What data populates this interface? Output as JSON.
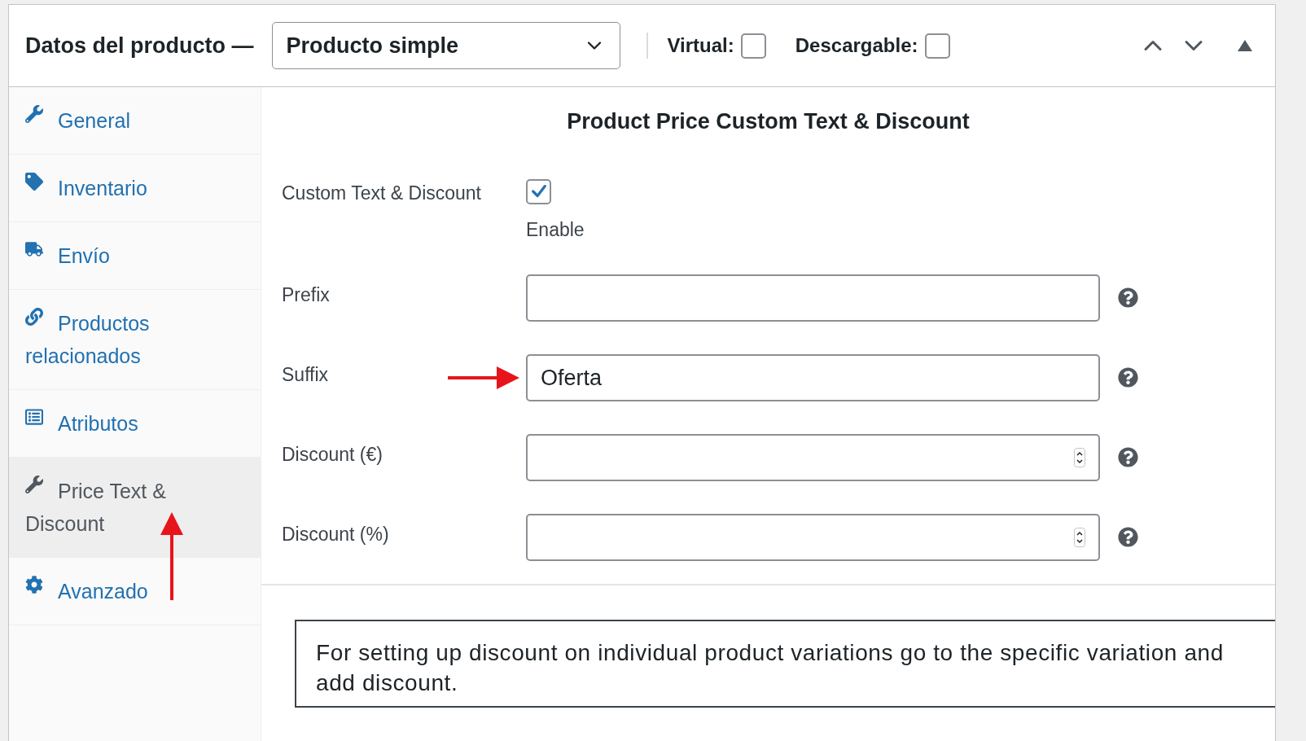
{
  "header": {
    "title": "Datos del producto —",
    "product_type": "Producto simple",
    "options": [
      {
        "label": "Virtual:",
        "checked": false
      },
      {
        "label": "Descargable:",
        "checked": false
      }
    ]
  },
  "sidebar": {
    "items": [
      {
        "label": "General",
        "kind": "wrench",
        "selected": false
      },
      {
        "label": "Inventario",
        "kind": "tag",
        "selected": false
      },
      {
        "label": "Envío",
        "kind": "truck",
        "selected": false
      },
      {
        "label": "Productos relacionados",
        "kind": "link",
        "selected": false
      },
      {
        "label": "Atributos",
        "kind": "list",
        "selected": false
      },
      {
        "label": "Price Text & Discount",
        "kind": "wrench",
        "selected": true
      },
      {
        "label": "Avanzado",
        "kind": "gear",
        "selected": false
      }
    ]
  },
  "section": {
    "title": "Product Price Custom Text & Discount",
    "enable": {
      "label": "Custom Text & Discount",
      "checked": true,
      "caption": "Enable"
    },
    "fields": [
      {
        "label": "Prefix",
        "kind": "text"
      },
      {
        "label": "Suffix",
        "kind": "text",
        "value": "Oferta"
      },
      {
        "label": "Discount (€)",
        "kind": "number"
      },
      {
        "label": "Discount (%)",
        "kind": "number"
      }
    ]
  },
  "notice": "For setting up discount on individual product variations go to the specific variation and add discount."
}
